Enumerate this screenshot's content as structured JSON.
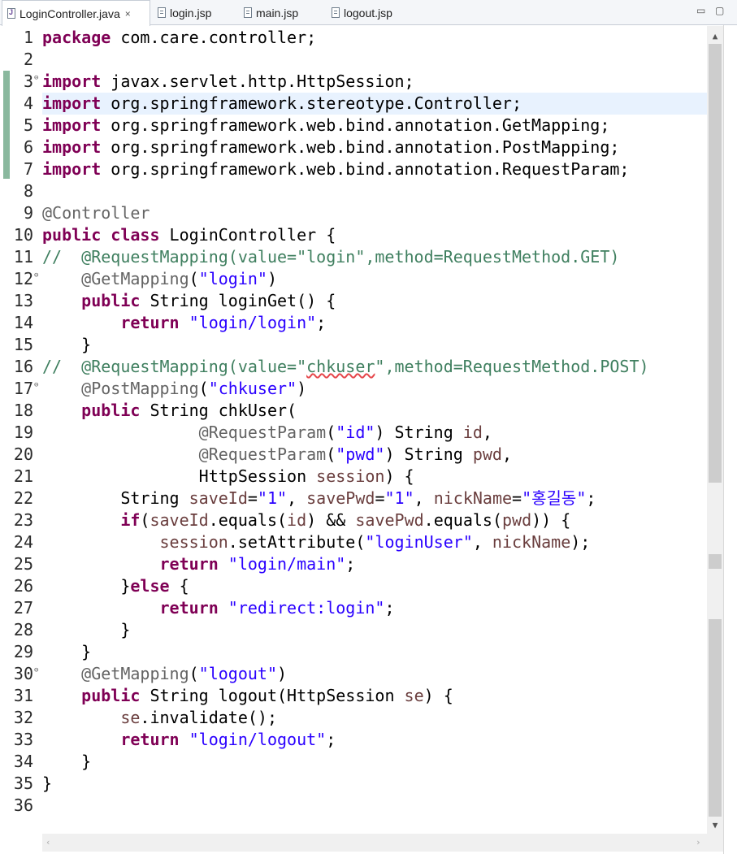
{
  "tabs": [
    {
      "label": "LoginController.java",
      "active": true,
      "icon": "java-file-icon",
      "close": "×"
    },
    {
      "label": "login.jsp",
      "active": false,
      "icon": "jsp-file-icon"
    },
    {
      "label": "main.jsp",
      "active": false,
      "icon": "jsp-file-icon"
    },
    {
      "label": "logout.jsp",
      "active": false,
      "icon": "jsp-file-icon"
    }
  ],
  "window_controls": {
    "minimize": "▭",
    "maximize": "▢"
  },
  "scroll_arrows": {
    "up": "▲",
    "down": "▼",
    "left": "‹",
    "right": "›"
  },
  "fold_marker": "⊖",
  "editor": {
    "current_line": 4,
    "folded_lines": [
      3,
      12,
      17,
      30
    ],
    "lines": [
      {
        "n": "1",
        "tokens": [
          {
            "t": "package",
            "c": "kw"
          },
          {
            "t": " com.care.controller;"
          }
        ]
      },
      {
        "n": "2",
        "tokens": []
      },
      {
        "n": "3",
        "tokens": [
          {
            "t": "import",
            "c": "kw"
          },
          {
            "t": " javax.servlet.http.HttpSession;"
          }
        ]
      },
      {
        "n": "4",
        "tokens": [
          {
            "t": "import",
            "c": "kw"
          },
          {
            "t": " org.springframework.stereotype.Controller;"
          }
        ]
      },
      {
        "n": "5",
        "tokens": [
          {
            "t": "import",
            "c": "kw"
          },
          {
            "t": " org.springframework.web.bind.annotation.GetMapping;"
          }
        ]
      },
      {
        "n": "6",
        "tokens": [
          {
            "t": "import",
            "c": "kw"
          },
          {
            "t": " org.springframework.web.bind.annotation.PostMapping;"
          }
        ]
      },
      {
        "n": "7",
        "tokens": [
          {
            "t": "import",
            "c": "kw"
          },
          {
            "t": " org.springframework.web.bind.annotation.RequestParam;"
          }
        ]
      },
      {
        "n": "8",
        "tokens": []
      },
      {
        "n": "9",
        "tokens": [
          {
            "t": "@Controller",
            "c": "ann"
          }
        ]
      },
      {
        "n": "10",
        "tokens": [
          {
            "t": "public",
            "c": "kw"
          },
          {
            "t": " "
          },
          {
            "t": "class",
            "c": "kw"
          },
          {
            "t": " LoginController {"
          }
        ]
      },
      {
        "n": "11",
        "tokens": [
          {
            "t": "//  @RequestMapping(value=\"login\",method=RequestMethod.GET)",
            "c": "cmt"
          }
        ]
      },
      {
        "n": "12",
        "tokens": [
          {
            "t": "    "
          },
          {
            "t": "@GetMapping",
            "c": "ann"
          },
          {
            "t": "("
          },
          {
            "t": "\"login\"",
            "c": "str"
          },
          {
            "t": ")"
          }
        ]
      },
      {
        "n": "13",
        "tokens": [
          {
            "t": "    "
          },
          {
            "t": "public",
            "c": "kw"
          },
          {
            "t": " String loginGet() {"
          }
        ]
      },
      {
        "n": "14",
        "tokens": [
          {
            "t": "        "
          },
          {
            "t": "return",
            "c": "kw"
          },
          {
            "t": " "
          },
          {
            "t": "\"login/login\"",
            "c": "str"
          },
          {
            "t": ";"
          }
        ]
      },
      {
        "n": "15",
        "tokens": [
          {
            "t": "    }"
          }
        ]
      },
      {
        "n": "16",
        "tokens": [
          {
            "t": "//  @RequestMapping(value=\"",
            "c": "cmt"
          },
          {
            "t": "chkuser",
            "c": "cmt spell"
          },
          {
            "t": "\",method=RequestMethod.POST)",
            "c": "cmt"
          }
        ]
      },
      {
        "n": "17",
        "tokens": [
          {
            "t": "    "
          },
          {
            "t": "@PostMapping",
            "c": "ann"
          },
          {
            "t": "("
          },
          {
            "t": "\"chkuser\"",
            "c": "str"
          },
          {
            "t": ")"
          }
        ]
      },
      {
        "n": "18",
        "tokens": [
          {
            "t": "    "
          },
          {
            "t": "public",
            "c": "kw"
          },
          {
            "t": " String chkUser("
          }
        ]
      },
      {
        "n": "19",
        "tokens": [
          {
            "t": "                "
          },
          {
            "t": "@RequestParam",
            "c": "ann"
          },
          {
            "t": "("
          },
          {
            "t": "\"id\"",
            "c": "str"
          },
          {
            "t": ") String "
          },
          {
            "t": "id",
            "c": "var"
          },
          {
            "t": ","
          }
        ]
      },
      {
        "n": "20",
        "tokens": [
          {
            "t": "                "
          },
          {
            "t": "@RequestParam",
            "c": "ann"
          },
          {
            "t": "("
          },
          {
            "t": "\"pwd\"",
            "c": "str"
          },
          {
            "t": ") String "
          },
          {
            "t": "pwd",
            "c": "var"
          },
          {
            "t": ","
          }
        ]
      },
      {
        "n": "21",
        "tokens": [
          {
            "t": "                HttpSession "
          },
          {
            "t": "session",
            "c": "var"
          },
          {
            "t": ") {"
          }
        ]
      },
      {
        "n": "22",
        "tokens": [
          {
            "t": "        String "
          },
          {
            "t": "saveId",
            "c": "var"
          },
          {
            "t": "="
          },
          {
            "t": "\"1\"",
            "c": "str"
          },
          {
            "t": ", "
          },
          {
            "t": "savePwd",
            "c": "var"
          },
          {
            "t": "="
          },
          {
            "t": "\"1\"",
            "c": "str"
          },
          {
            "t": ", "
          },
          {
            "t": "nickName",
            "c": "var"
          },
          {
            "t": "="
          },
          {
            "t": "\"홍길동\"",
            "c": "str"
          },
          {
            "t": ";"
          }
        ]
      },
      {
        "n": "23",
        "tokens": [
          {
            "t": "        "
          },
          {
            "t": "if",
            "c": "kw"
          },
          {
            "t": "("
          },
          {
            "t": "saveId",
            "c": "var"
          },
          {
            "t": ".equals("
          },
          {
            "t": "id",
            "c": "var"
          },
          {
            "t": ") && "
          },
          {
            "t": "savePwd",
            "c": "var"
          },
          {
            "t": ".equals("
          },
          {
            "t": "pwd",
            "c": "var"
          },
          {
            "t": ")) {"
          }
        ]
      },
      {
        "n": "24",
        "tokens": [
          {
            "t": "            "
          },
          {
            "t": "session",
            "c": "var"
          },
          {
            "t": ".setAttribute("
          },
          {
            "t": "\"loginUser\"",
            "c": "str"
          },
          {
            "t": ", "
          },
          {
            "t": "nickName",
            "c": "var"
          },
          {
            "t": ");"
          }
        ]
      },
      {
        "n": "25",
        "tokens": [
          {
            "t": "            "
          },
          {
            "t": "return",
            "c": "kw"
          },
          {
            "t": " "
          },
          {
            "t": "\"login/main\"",
            "c": "str"
          },
          {
            "t": ";"
          }
        ]
      },
      {
        "n": "26",
        "tokens": [
          {
            "t": "        }"
          },
          {
            "t": "else",
            "c": "kw"
          },
          {
            "t": " {"
          }
        ]
      },
      {
        "n": "27",
        "tokens": [
          {
            "t": "            "
          },
          {
            "t": "return",
            "c": "kw"
          },
          {
            "t": " "
          },
          {
            "t": "\"redirect:login\"",
            "c": "str"
          },
          {
            "t": ";"
          }
        ]
      },
      {
        "n": "28",
        "tokens": [
          {
            "t": "        }"
          }
        ]
      },
      {
        "n": "29",
        "tokens": [
          {
            "t": "    }"
          }
        ]
      },
      {
        "n": "30",
        "tokens": [
          {
            "t": "    "
          },
          {
            "t": "@GetMapping",
            "c": "ann"
          },
          {
            "t": "("
          },
          {
            "t": "\"logout\"",
            "c": "str"
          },
          {
            "t": ")"
          }
        ]
      },
      {
        "n": "31",
        "tokens": [
          {
            "t": "    "
          },
          {
            "t": "public",
            "c": "kw"
          },
          {
            "t": " String logout(HttpSession "
          },
          {
            "t": "se",
            "c": "var"
          },
          {
            "t": ") {"
          }
        ]
      },
      {
        "n": "32",
        "tokens": [
          {
            "t": "        "
          },
          {
            "t": "se",
            "c": "var"
          },
          {
            "t": ".invalidate();"
          }
        ]
      },
      {
        "n": "33",
        "tokens": [
          {
            "t": "        "
          },
          {
            "t": "return",
            "c": "kw"
          },
          {
            "t": " "
          },
          {
            "t": "\"login/logout\"",
            "c": "str"
          },
          {
            "t": ";"
          }
        ]
      },
      {
        "n": "34",
        "tokens": [
          {
            "t": "    }"
          }
        ]
      },
      {
        "n": "35",
        "tokens": [
          {
            "t": "}"
          }
        ]
      },
      {
        "n": "36",
        "tokens": []
      }
    ]
  }
}
